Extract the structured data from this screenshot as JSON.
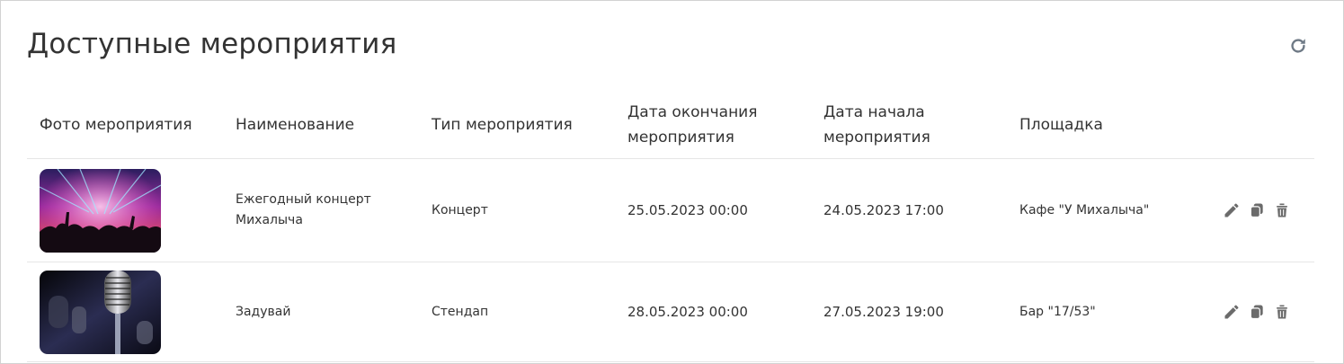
{
  "page": {
    "title": "Доступные мероприятия"
  },
  "colors": {
    "icon": "#6b6b6b",
    "border": "#d2d2d2",
    "divider": "#e6e6e6"
  },
  "table": {
    "headers": {
      "photo": "Фото мероприятия",
      "name": "Наименование",
      "type": "Тип мероприятия",
      "end_date": "Дата окончания мероприятия",
      "start_date": "Дата начала мероприятия",
      "venue": "Площадка"
    },
    "rows": [
      {
        "photo_icon": "concert-photo",
        "name": "Ежегодный концерт Михалыча",
        "type": "Концерт",
        "end_date": "25.05.2023 00:00",
        "start_date": "24.05.2023 17:00",
        "venue": "Кафе \"У Михалыча\""
      },
      {
        "photo_icon": "microphone-photo",
        "name": "Задувай",
        "type": "Стендап",
        "end_date": "28.05.2023 00:00",
        "start_date": "27.05.2023 19:00",
        "venue": "Бар \"17/53\""
      }
    ],
    "row_actions": [
      "pencil-icon",
      "copy-icon",
      "trash-icon"
    ]
  }
}
